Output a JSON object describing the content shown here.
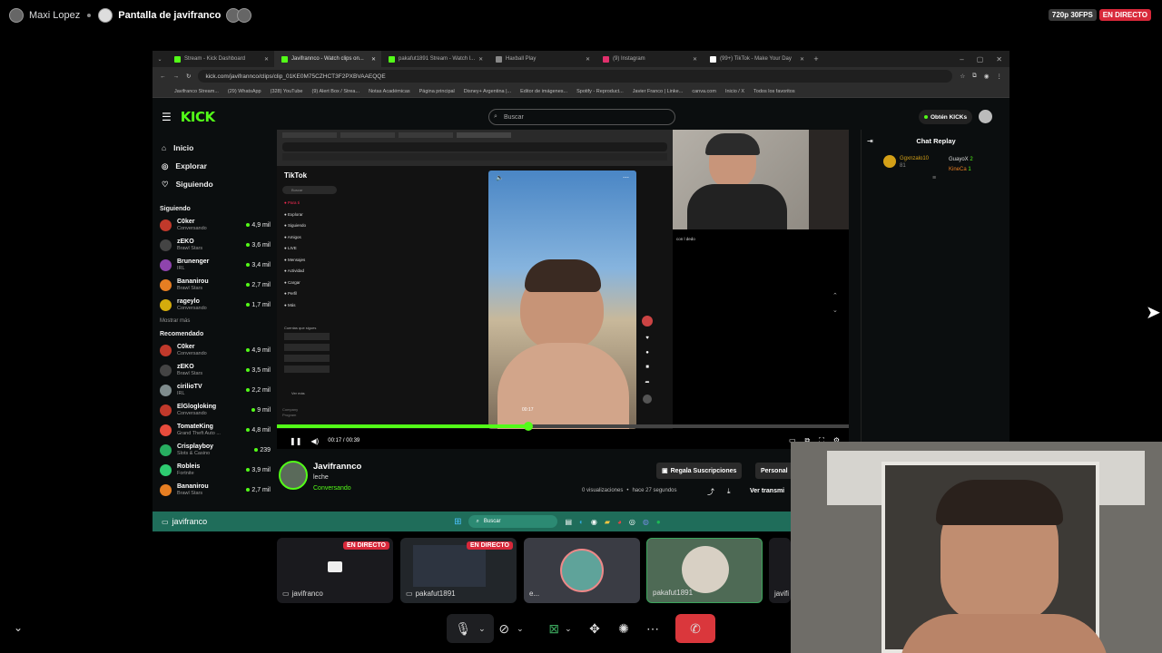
{
  "discord": {
    "user": "Maxi Lopez",
    "screen_title": "Pantalla de javifranco",
    "quality": "720p 30FPS",
    "live": "EN DIRECTO"
  },
  "browser": {
    "tabs": [
      {
        "label": "Stream - Kick Dashboard",
        "color": "#53fc18"
      },
      {
        "label": "Javifrannco - Watch clips on...",
        "color": "#53fc18"
      },
      {
        "label": "pakafut1891 Stream - Watch l...",
        "color": "#53fc18"
      },
      {
        "label": "Haxball Play",
        "color": "#888888"
      },
      {
        "label": "(9) Instagram",
        "color": "#e1306c"
      },
      {
        "label": "(99+) TikTok - Make Your Day",
        "color": "#ffffff"
      }
    ],
    "url": "kick.com/javifrannco/clips/clip_01KE0M75CZHCT3F2PXBVAAEQQE",
    "bookmarks": [
      "Javifranco Stream...",
      "(29) WhatsApp",
      "(328) YouTube",
      "(9) Alert Box / Strea...",
      "Notas Académicas",
      "Página principal",
      "Disney+ Argentina |...",
      "Editor de imágenes...",
      "Spotify - Reproduct...",
      "Javier Franco | Linke...",
      "canva.com",
      "Inicio / X",
      "Todos los favoritos"
    ]
  },
  "kick": {
    "logo": "KICK",
    "search_placeholder": "Buscar",
    "get_kicks": "Obtén KICKs",
    "nav": [
      {
        "label": "Inicio",
        "icon": "home-icon",
        "glyph": "⌂"
      },
      {
        "label": "Explorar",
        "icon": "compass-icon",
        "glyph": "◎"
      },
      {
        "label": "Siguiendo",
        "icon": "heart-icon",
        "glyph": "♡"
      }
    ],
    "following_title": "Siguiendo",
    "following": [
      {
        "name": "C0ker",
        "sub": "Conversando",
        "viewers": "4,9 mil",
        "color": "#c0392b"
      },
      {
        "name": "zEKO",
        "sub": "Brawl Stars",
        "viewers": "3,6 mil",
        "color": "#444444"
      },
      {
        "name": "Brunenger",
        "sub": "IRL",
        "viewers": "3,4 mil",
        "color": "#8e44ad"
      },
      {
        "name": "Bananirou",
        "sub": "Brawl Stars",
        "viewers": "2,7 mil",
        "color": "#e67e22"
      },
      {
        "name": "rageylo",
        "sub": "Conversando",
        "viewers": "1,7 mil",
        "color": "#d4ac0d"
      }
    ],
    "show_more": "Mostrar más",
    "recommended_title": "Recomendado",
    "recommended": [
      {
        "name": "C0ker",
        "sub": "Conversando",
        "viewers": "4,9 mil",
        "color": "#c0392b"
      },
      {
        "name": "zEKO",
        "sub": "Brawl Stars",
        "viewers": "3,5 mil",
        "color": "#444444"
      },
      {
        "name": "cirilioTV",
        "sub": "IRL",
        "viewers": "2,2 mil",
        "color": "#7f8c8d"
      },
      {
        "name": "ElGlogloking",
        "sub": "Conversando",
        "viewers": "9 mil",
        "color": "#c0392b"
      },
      {
        "name": "TomateKing",
        "sub": "Grand Theft Auto ...",
        "viewers": "4,8 mil",
        "color": "#e74c3c"
      },
      {
        "name": "Crisplayboy",
        "sub": "Slots & Casino",
        "viewers": "239",
        "color": "#27ae60"
      },
      {
        "name": "Robleis",
        "sub": "Fortnite",
        "viewers": "3,9 mil",
        "color": "#2ecc71"
      },
      {
        "name": "Bananirou",
        "sub": "Brawl Stars",
        "viewers": "2,7 mil",
        "color": "#e67e22"
      }
    ],
    "channel": {
      "name": "Javifrannco",
      "title": "leche",
      "category": "Conversando",
      "views": "0 visualizaciones",
      "ago": "hace 27 segundos",
      "gift_subs": "Regala Suscripciones",
      "personalize": "Personal",
      "watch_stream": "Ver transmi"
    },
    "player": {
      "time": "00:17 / 00:39",
      "progress": 0.44,
      "tooltip": "00:17",
      "webcam_caption": "con l dedo"
    },
    "chat": {
      "title": "Chat Replay",
      "users": [
        {
          "name": "Ggxnzalo10",
          "count": "81"
        },
        {
          "name": "GuayoX",
          "count": "2"
        },
        {
          "name": "KineCa",
          "count": "1"
        }
      ]
    },
    "tiktok": {
      "brand": "TikTok",
      "search": "Buscar",
      "menu": [
        "Para ti",
        "Explorar",
        "Siguiendo",
        "Amigos",
        "LIVE",
        "Mensajes",
        "Actividad",
        "Cargar",
        "Perfil",
        "Más"
      ],
      "following_header": "Cuentas que sigues",
      "see_more": "Ver más",
      "footer": [
        "Company",
        "Program"
      ]
    },
    "taskbar_user": "javifranco",
    "taskbar_search": "Buscar"
  },
  "tiles": [
    {
      "label": "javifranco",
      "live": "EN DIRECTO"
    },
    {
      "label": "pakafut1891",
      "live": "EN DIRECTO"
    },
    {
      "label": "e..."
    },
    {
      "label": "pakafut1891"
    },
    {
      "label": "javifi"
    }
  ]
}
